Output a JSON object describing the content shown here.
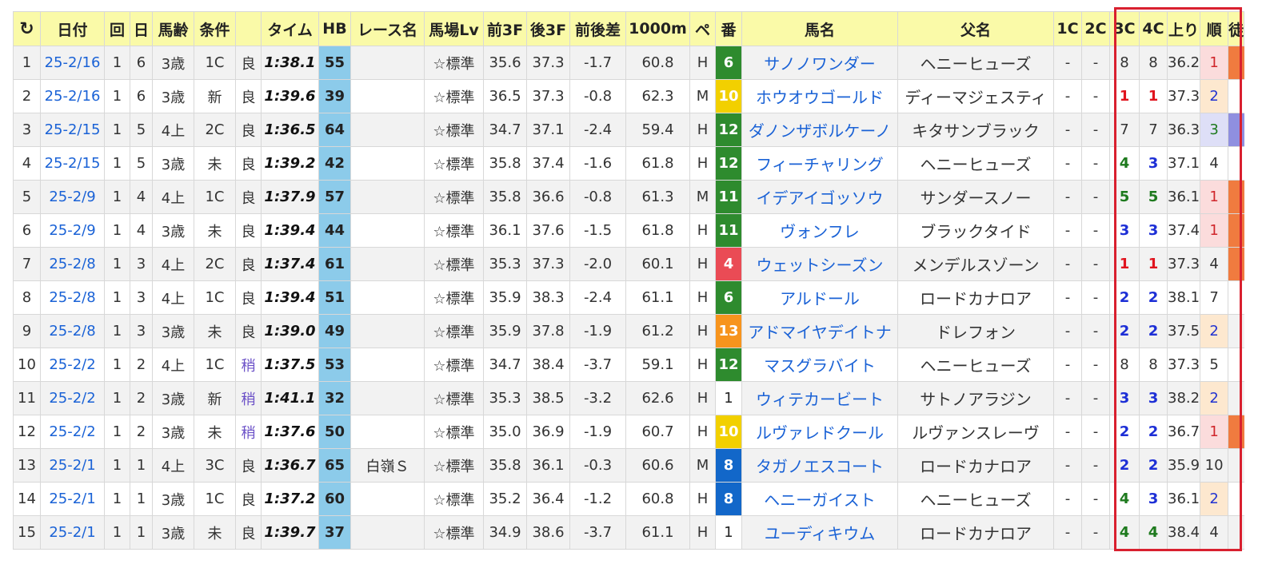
{
  "table": {
    "columns": [
      "日付",
      "回",
      "日",
      "馬齢",
      "条件",
      "",
      "タイム",
      "HB",
      "レース名",
      "馬場Lv",
      "前3F",
      "後3F",
      "前後差",
      "1000m",
      "ペ",
      "番",
      "馬名",
      "父名",
      "1C",
      "2C",
      "3C",
      "4C",
      "上り",
      "順",
      "徒"
    ],
    "rows": [
      {
        "no": "1",
        "date": "25-2/16",
        "kai": "1",
        "day": "6",
        "age": "3歳",
        "cond": "1C",
        "track": "良",
        "time": "1:38.1",
        "hb": "55",
        "race": "",
        "baba": "☆標準",
        "f3": "35.6",
        "l3": "37.3",
        "diff": "-1.7",
        "m1000": "60.8",
        "pace": "H",
        "ban": "6",
        "horse": "サノノワンダー",
        "sire": "ヘニーヒューズ",
        "c1": "-",
        "c2": "-",
        "c3": "8",
        "c4": "8",
        "agari": "36.2",
        "rank": "1"
      },
      {
        "no": "2",
        "date": "25-2/16",
        "kai": "1",
        "day": "6",
        "age": "3歳",
        "cond": "新",
        "track": "良",
        "time": "1:39.6",
        "hb": "39",
        "race": "",
        "baba": "☆標準",
        "f3": "36.5",
        "l3": "37.3",
        "diff": "-0.8",
        "m1000": "62.3",
        "pace": "M",
        "ban": "10",
        "horse": "ホウオウゴールド",
        "sire": "ディーマジェスティ",
        "c1": "-",
        "c2": "-",
        "c3": "1",
        "c4": "1",
        "agari": "37.3",
        "rank": "2"
      },
      {
        "no": "3",
        "date": "25-2/15",
        "kai": "1",
        "day": "5",
        "age": "4上",
        "cond": "2C",
        "track": "良",
        "time": "1:36.5",
        "hb": "64",
        "race": "",
        "baba": "☆標準",
        "f3": "34.7",
        "l3": "37.1",
        "diff": "-2.4",
        "m1000": "59.4",
        "pace": "H",
        "ban": "12",
        "horse": "ダノンザボルケーノ",
        "sire": "キタサンブラック",
        "c1": "-",
        "c2": "-",
        "c3": "7",
        "c4": "7",
        "agari": "36.3",
        "rank": "3"
      },
      {
        "no": "4",
        "date": "25-2/15",
        "kai": "1",
        "day": "5",
        "age": "3歳",
        "cond": "未",
        "track": "良",
        "time": "1:39.2",
        "hb": "42",
        "race": "",
        "baba": "☆標準",
        "f3": "35.8",
        "l3": "37.4",
        "diff": "-1.6",
        "m1000": "61.8",
        "pace": "H",
        "ban": "12",
        "horse": "フィーチャリング",
        "sire": "ヘニーヒューズ",
        "c1": "-",
        "c2": "-",
        "c3": "4",
        "c4": "3",
        "agari": "37.1",
        "rank": "4"
      },
      {
        "no": "5",
        "date": "25-2/9",
        "kai": "1",
        "day": "4",
        "age": "4上",
        "cond": "1C",
        "track": "良",
        "time": "1:37.9",
        "hb": "57",
        "race": "",
        "baba": "☆標準",
        "f3": "35.8",
        "l3": "36.6",
        "diff": "-0.8",
        "m1000": "61.3",
        "pace": "M",
        "ban": "11",
        "horse": "イデアイゴッソウ",
        "sire": "サンダースノー",
        "c1": "-",
        "c2": "-",
        "c3": "5",
        "c4": "5",
        "agari": "36.1",
        "rank": "1"
      },
      {
        "no": "6",
        "date": "25-2/9",
        "kai": "1",
        "day": "4",
        "age": "3歳",
        "cond": "未",
        "track": "良",
        "time": "1:39.4",
        "hb": "44",
        "race": "",
        "baba": "☆標準",
        "f3": "36.1",
        "l3": "37.6",
        "diff": "-1.5",
        "m1000": "61.8",
        "pace": "H",
        "ban": "11",
        "horse": "ヴォンフレ",
        "sire": "ブラックタイド",
        "c1": "-",
        "c2": "-",
        "c3": "3",
        "c4": "3",
        "agari": "37.4",
        "rank": "1"
      },
      {
        "no": "7",
        "date": "25-2/8",
        "kai": "1",
        "day": "3",
        "age": "4上",
        "cond": "2C",
        "track": "良",
        "time": "1:37.4",
        "hb": "61",
        "race": "",
        "baba": "☆標準",
        "f3": "35.3",
        "l3": "37.3",
        "diff": "-2.0",
        "m1000": "60.1",
        "pace": "H",
        "ban": "4",
        "horse": "ウェットシーズン",
        "sire": "メンデルスゾーン",
        "c1": "-",
        "c2": "-",
        "c3": "1",
        "c4": "1",
        "agari": "37.3",
        "rank": "4"
      },
      {
        "no": "8",
        "date": "25-2/8",
        "kai": "1",
        "day": "3",
        "age": "4上",
        "cond": "1C",
        "track": "良",
        "time": "1:39.4",
        "hb": "51",
        "race": "",
        "baba": "☆標準",
        "f3": "35.9",
        "l3": "38.3",
        "diff": "-2.4",
        "m1000": "61.1",
        "pace": "H",
        "ban": "6",
        "horse": "アルドール",
        "sire": "ロードカナロア",
        "c1": "-",
        "c2": "-",
        "c3": "2",
        "c4": "2",
        "agari": "38.1",
        "rank": "7"
      },
      {
        "no": "9",
        "date": "25-2/8",
        "kai": "1",
        "day": "3",
        "age": "3歳",
        "cond": "未",
        "track": "良",
        "time": "1:39.0",
        "hb": "49",
        "race": "",
        "baba": "☆標準",
        "f3": "35.9",
        "l3": "37.8",
        "diff": "-1.9",
        "m1000": "61.2",
        "pace": "H",
        "ban": "13",
        "horse": "アドマイヤデイトナ",
        "sire": "ドレフォン",
        "c1": "-",
        "c2": "-",
        "c3": "2",
        "c4": "2",
        "agari": "37.5",
        "rank": "2"
      },
      {
        "no": "10",
        "date": "25-2/2",
        "kai": "1",
        "day": "2",
        "age": "4上",
        "cond": "1C",
        "track": "稍",
        "time": "1:37.5",
        "hb": "53",
        "race": "",
        "baba": "☆標準",
        "f3": "34.7",
        "l3": "38.4",
        "diff": "-3.7",
        "m1000": "59.1",
        "pace": "H",
        "ban": "12",
        "horse": "マスグラバイト",
        "sire": "ヘニーヒューズ",
        "c1": "-",
        "c2": "-",
        "c3": "8",
        "c4": "8",
        "agari": "37.3",
        "rank": "5"
      },
      {
        "no": "11",
        "date": "25-2/2",
        "kai": "1",
        "day": "2",
        "age": "3歳",
        "cond": "新",
        "track": "稍",
        "time": "1:41.1",
        "hb": "32",
        "race": "",
        "baba": "☆標準",
        "f3": "35.3",
        "l3": "38.5",
        "diff": "-3.2",
        "m1000": "62.6",
        "pace": "H",
        "ban": "1",
        "horse": "ウィテカービート",
        "sire": "サトノアラジン",
        "c1": "-",
        "c2": "-",
        "c3": "3",
        "c4": "3",
        "agari": "38.2",
        "rank": "2"
      },
      {
        "no": "12",
        "date": "25-2/2",
        "kai": "1",
        "day": "2",
        "age": "3歳",
        "cond": "未",
        "track": "稍",
        "time": "1:37.6",
        "hb": "50",
        "race": "",
        "baba": "☆標準",
        "f3": "35.0",
        "l3": "36.9",
        "diff": "-1.9",
        "m1000": "60.7",
        "pace": "H",
        "ban": "10",
        "horse": "ルヴァレドクール",
        "sire": "ルヴァンスレーヴ",
        "c1": "-",
        "c2": "-",
        "c3": "2",
        "c4": "2",
        "agari": "36.7",
        "rank": "1"
      },
      {
        "no": "13",
        "date": "25-2/1",
        "kai": "1",
        "day": "1",
        "age": "4上",
        "cond": "3C",
        "track": "良",
        "time": "1:36.7",
        "hb": "65",
        "race": "白嶺Ｓ",
        "baba": "☆標準",
        "f3": "35.8",
        "l3": "36.1",
        "diff": "-0.3",
        "m1000": "60.6",
        "pace": "M",
        "ban": "8",
        "horse": "タガノエスコート",
        "sire": "ロードカナロア",
        "c1": "-",
        "c2": "-",
        "c3": "2",
        "c4": "2",
        "agari": "35.9",
        "rank": "10"
      },
      {
        "no": "14",
        "date": "25-2/1",
        "kai": "1",
        "day": "1",
        "age": "3歳",
        "cond": "1C",
        "track": "良",
        "time": "1:37.2",
        "hb": "60",
        "race": "",
        "baba": "☆標準",
        "f3": "35.2",
        "l3": "36.4",
        "diff": "-1.2",
        "m1000": "60.8",
        "pace": "H",
        "ban": "8",
        "horse": "ヘニーガイスト",
        "sire": "ヘニーヒューズ",
        "c1": "-",
        "c2": "-",
        "c3": "4",
        "c4": "3",
        "agari": "36.1",
        "rank": "2"
      },
      {
        "no": "15",
        "date": "25-2/1",
        "kai": "1",
        "day": "1",
        "age": "3歳",
        "cond": "未",
        "track": "良",
        "time": "1:39.7",
        "hb": "37",
        "race": "",
        "baba": "☆標準",
        "f3": "34.9",
        "l3": "38.6",
        "diff": "-3.7",
        "m1000": "61.1",
        "pace": "H",
        "ban": "1",
        "horse": "ユーディキウム",
        "sire": "ロードカナロア",
        "c1": "-",
        "c2": "-",
        "c3": "4",
        "c4": "4",
        "agari": "38.4",
        "rank": "4"
      }
    ]
  },
  "colors": {
    "header_bg": "#fafaa8",
    "hb_bg": "#8ccbea",
    "link": "#1a62d6",
    "highlight_border": "#d9202f",
    "waku": {
      "1": "#ffffff",
      "4": "#ea4b55",
      "6": "#2e8b2e",
      "8": "#1267c9",
      "10": "#f2d000",
      "11": "#2e8b2e",
      "12": "#2e8b2e",
      "13": "#f7941d"
    },
    "pos": {
      "1": "#e0141e",
      "2": "#1d2fd6",
      "3": "#1d2fd6",
      "4": "#1e7a1e",
      "5": "#1e7a1e"
    },
    "right_strip": "#f07b3f"
  },
  "icons": {
    "refresh": "refresh-icon"
  }
}
